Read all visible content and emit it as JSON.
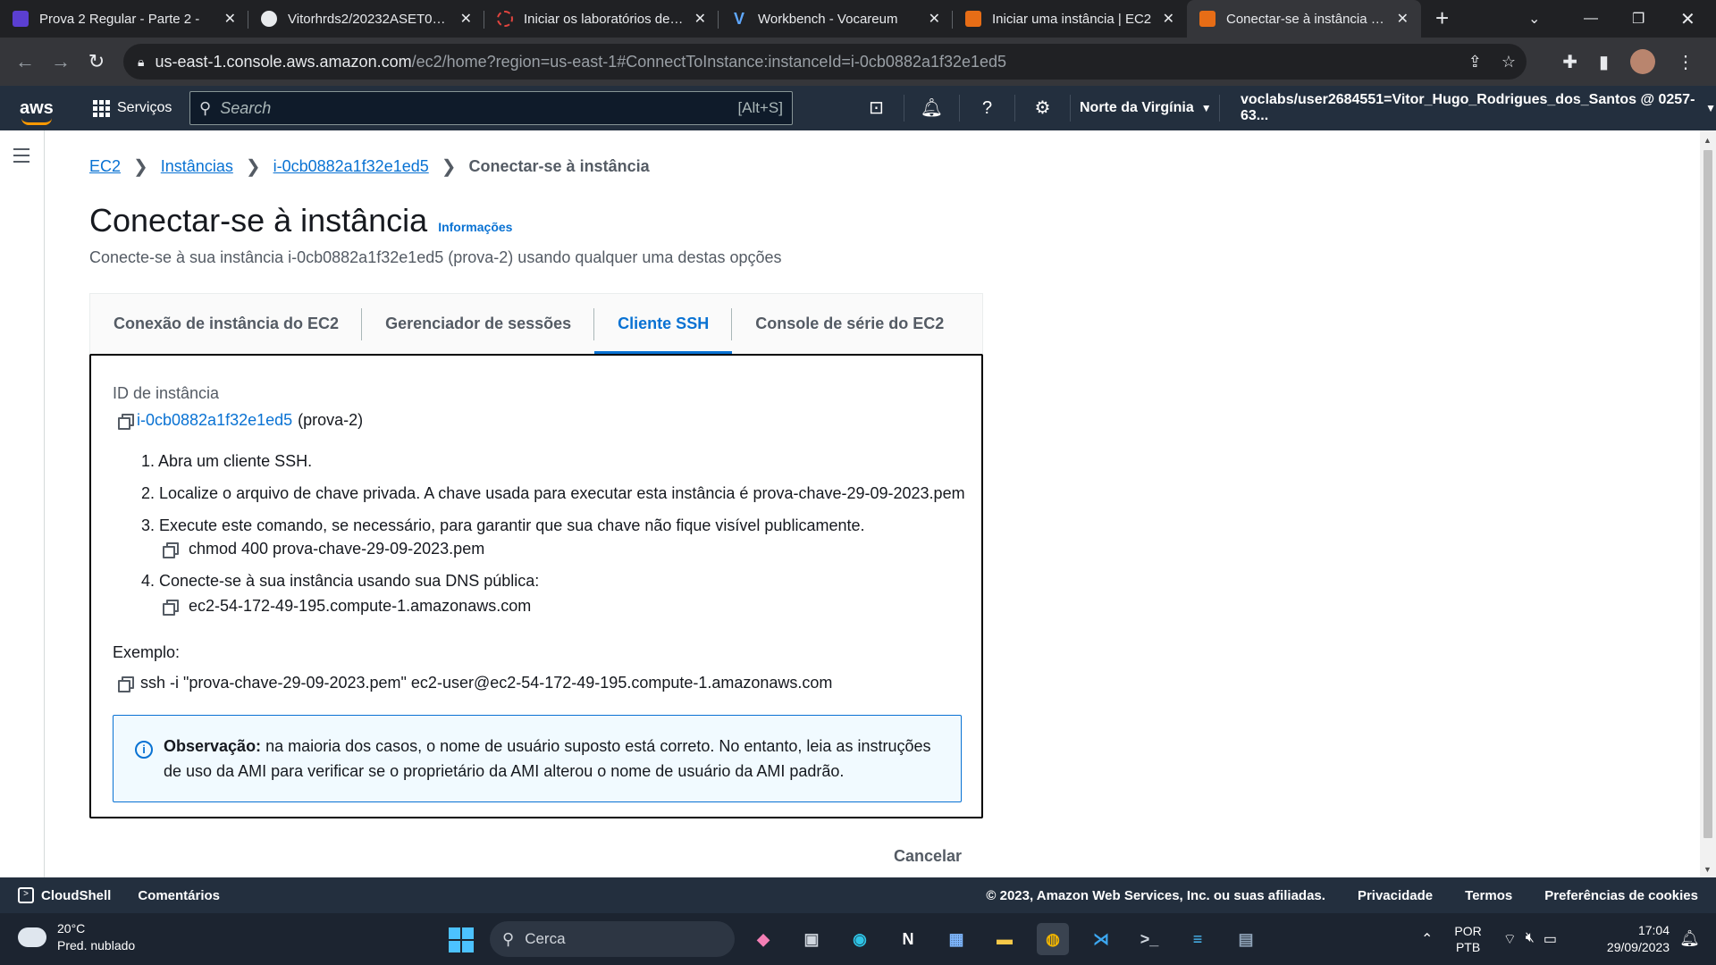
{
  "browser": {
    "tabs": [
      {
        "title": "Prova 2 Regular - Parte 2 -",
        "favicon": "form-icon",
        "active": false
      },
      {
        "title": "Vitorhrds2/20232ASET06P...",
        "favicon": "github-icon",
        "active": false
      },
      {
        "title": "Iniciar os laboratórios de a...",
        "favicon": "lab-icon",
        "active": false
      },
      {
        "title": "Workbench - Vocareum",
        "favicon": "vocareum-icon",
        "active": false
      },
      {
        "title": "Iniciar uma instância | EC2",
        "favicon": "aws-icon",
        "active": false
      },
      {
        "title": "Conectar-se à instância | E...",
        "favicon": "aws-icon",
        "active": true
      }
    ],
    "url_host": "us-east-1.console.aws.amazon.com",
    "url_path": "/ec2/home?region=us-east-1#ConnectToInstance:instanceId=i-0cb0882a1f32e1ed5"
  },
  "aws_nav": {
    "logo": "aws",
    "services_label": "Serviços",
    "search_placeholder": "Search",
    "search_shortcut": "[Alt+S]",
    "region": "Norte da Virgínia",
    "account": "voclabs/user2684551=Vitor_Hugo_Rodrigues_dos_Santos @ 0257-63..."
  },
  "breadcrumb": {
    "items": [
      "EC2",
      "Instâncias",
      "i-0cb0882a1f32e1ed5"
    ],
    "current": "Conectar-se à instância"
  },
  "page": {
    "title": "Conectar-se à instância",
    "info_link": "Informações",
    "subtitle": "Conecte-se à sua instância i-0cb0882a1f32e1ed5 (prova-2) usando qualquer uma destas opções"
  },
  "tabs": [
    {
      "label": "Conexão de instância do EC2",
      "active": false
    },
    {
      "label": "Gerenciador de sessões",
      "active": false
    },
    {
      "label": "Cliente SSH",
      "active": true
    },
    {
      "label": "Console de série do EC2",
      "active": false
    }
  ],
  "ssh": {
    "instance_id_label": "ID de instância",
    "instance_id": "i-0cb0882a1f32e1ed5",
    "instance_name": "(prova-2)",
    "steps": [
      "1. Abra um cliente SSH.",
      "2. Localize o arquivo de chave privada. A chave usada para executar esta instância é prova-chave-29-09-2023.pem",
      "3. Execute este comando, se necessário, para garantir que sua chave não fique visível publicamente.",
      "4. Conecte-se à sua instância usando sua DNS pública:"
    ],
    "chmod_command": "chmod 400 prova-chave-29-09-2023.pem",
    "public_dns": "ec2-54-172-49-195.compute-1.amazonaws.com",
    "example_label": "Exemplo:",
    "example_command": "ssh -i \"prova-chave-29-09-2023.pem\" ec2-user@ec2-54-172-49-195.compute-1.amazonaws.com",
    "note_bold": "Observação:",
    "note_text": " na maioria dos casos, o nome de usuário suposto está correto. No entanto, leia as instruções de uso da AMI para verificar se o proprietário da AMI alterou o nome de usuário da AMI padrão."
  },
  "actions": {
    "cancel": "Cancelar"
  },
  "footer": {
    "cloudshell": "CloudShell",
    "comments": "Comentários",
    "copyright": "© 2023, Amazon Web Services, Inc. ou suas afiliadas.",
    "privacy": "Privacidade",
    "terms": "Termos",
    "cookies": "Preferências de cookies"
  },
  "taskbar": {
    "temperature": "20°C",
    "weather": "Pred. nublado",
    "search_placeholder": "Cerca",
    "lang_line1": "POR",
    "lang_line2": "PTB",
    "time": "17:04",
    "date": "29/09/2023"
  },
  "colors": {
    "aws_nav": "#232f3e",
    "link": "#0972d3",
    "alert_bg": "#f1faff"
  }
}
